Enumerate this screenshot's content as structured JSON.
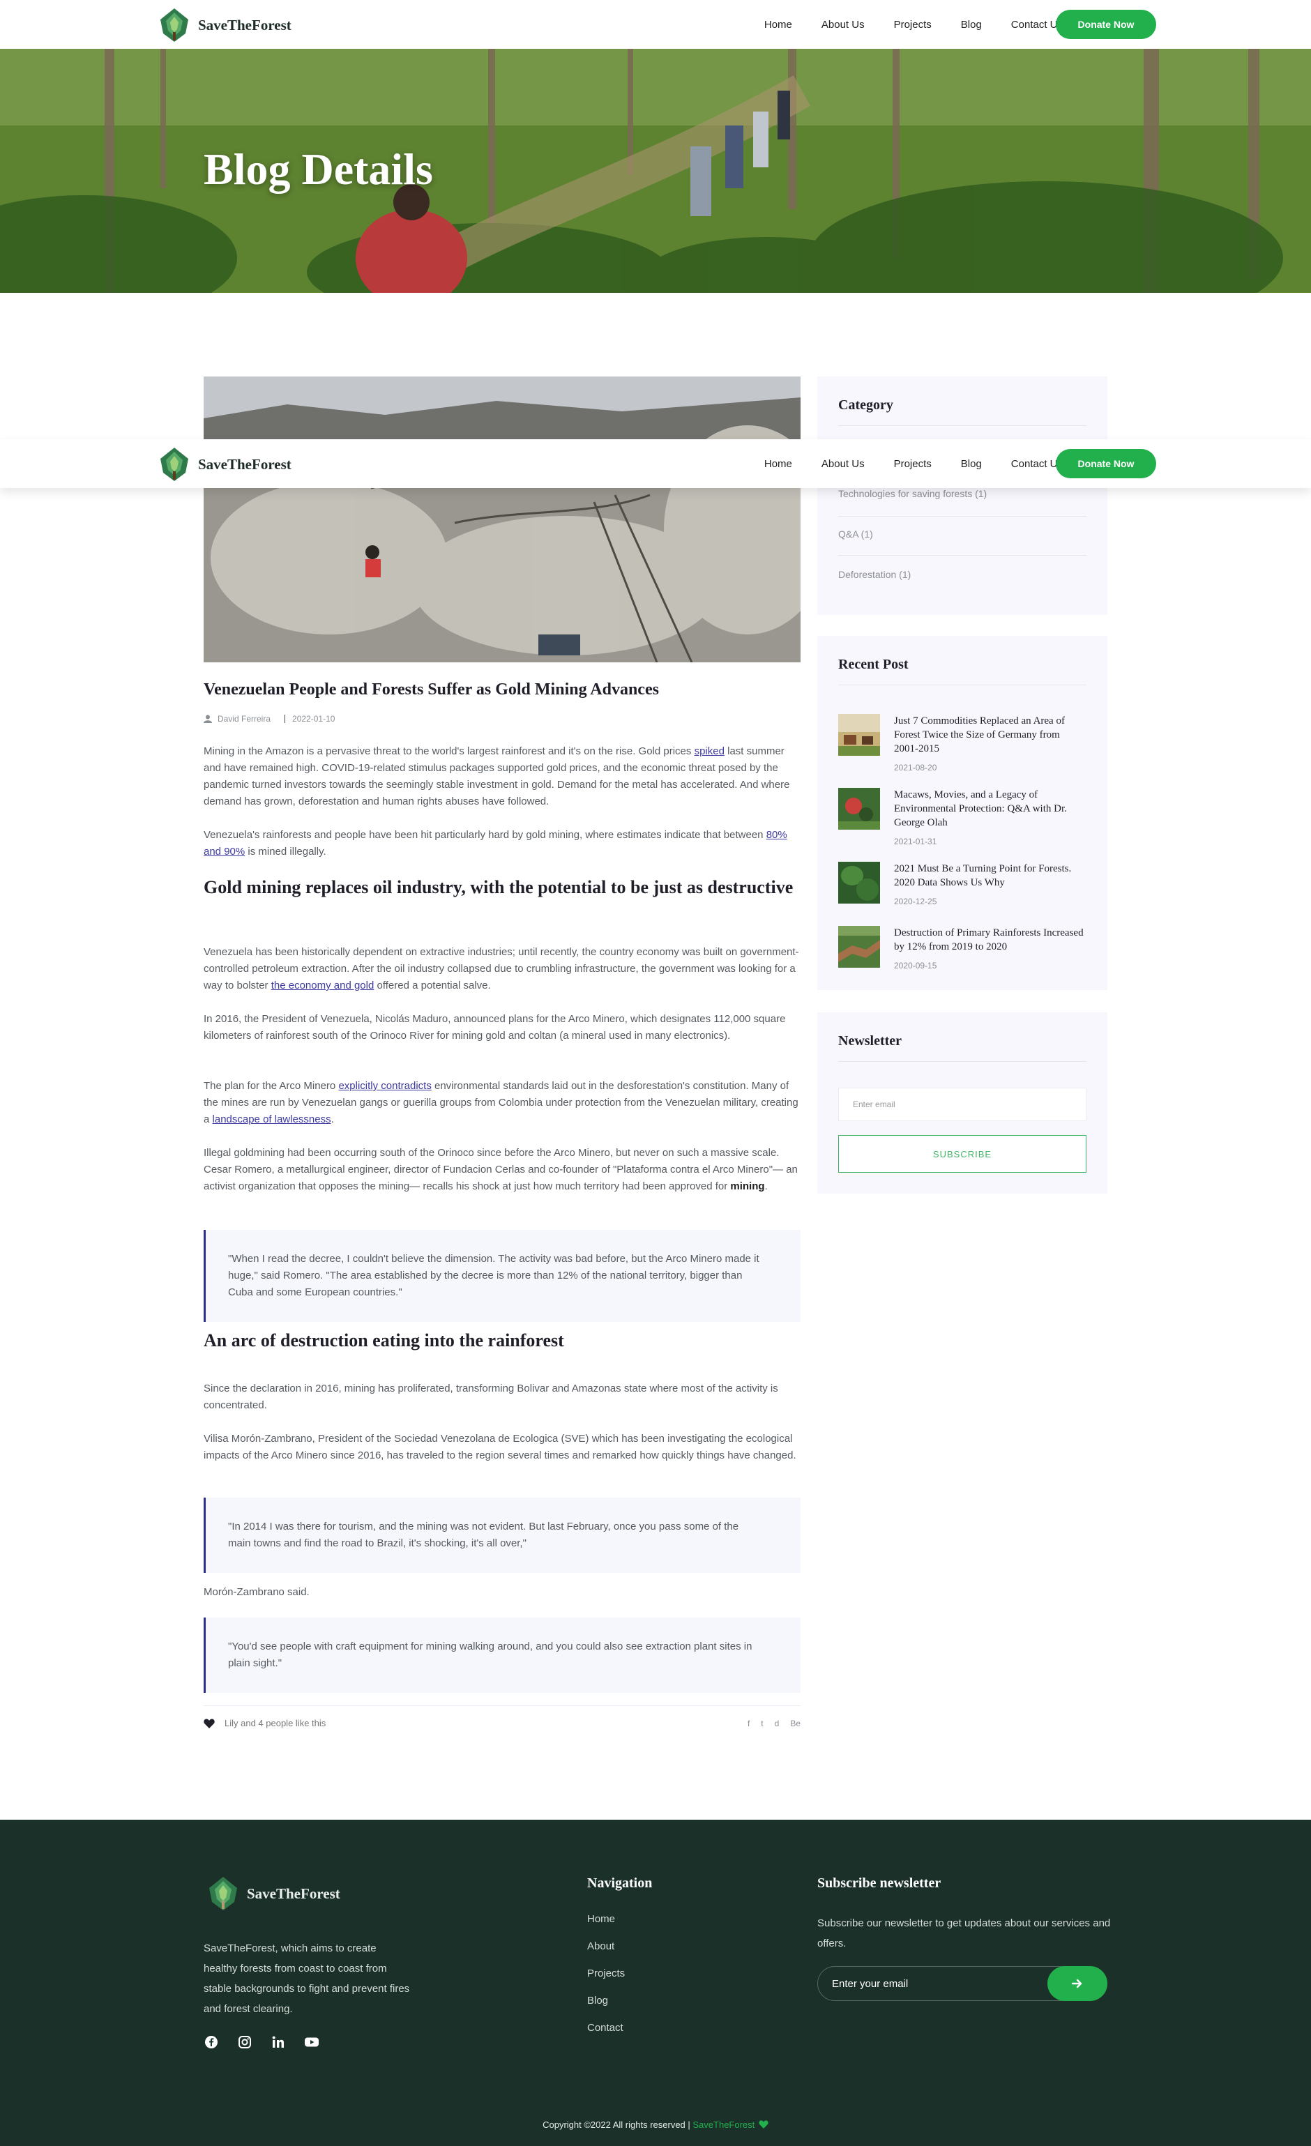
{
  "brand": {
    "name": "SaveTheForest"
  },
  "nav": {
    "items": [
      "Home",
      "About Us",
      "Projects",
      "Blog",
      "Contact Us"
    ],
    "donate": "Donate Now"
  },
  "hero": {
    "title": "Blog Details"
  },
  "post": {
    "title": "Venezuelan People and Forests Suffer as Gold Mining Advances",
    "author": "David Ferreira",
    "date": "2022-01-10",
    "p1": {
      "a": "Mining in the Amazon is a pervasive threat to the world's largest rainforest and it's on the rise. Gold prices ",
      "link": "spiked",
      "b": " last summer and have remained high. COVID-19-related stimulus packages supported gold prices, and the economic threat posed by the pandemic turned investors towards the seemingly stable investment in gold. Demand for the metal has accelerated. And where demand has grown, deforestation and human rights abuses have followed."
    },
    "p2": {
      "a": "Venezuela's rainforests and people have been hit particularly hard by gold mining, where estimates indicate that between ",
      "link": "80% and 90%",
      "b": " is mined illegally."
    },
    "h1": "Gold mining replaces oil industry, with the potential to be just as destructive",
    "p3": {
      "a": "Venezuela has been historically dependent on extractive industries; until recently, the country economy was built on government-controlled petroleum extraction. After the oil industry collapsed due to crumbling infrastructure, the government was looking for a way to bolster ",
      "link": "the economy and gold",
      "b": " offered a potential salve."
    },
    "p4": "In 2016, the President of Venezuela, Nicolás Maduro, announced plans for the Arco Minero, which designates 112,000 square kilometers of rainforest south of the Orinoco River for mining gold and coltan (a mineral used in many electronics).",
    "p5": {
      "a": "The plan for the Arco Minero ",
      "link1": "explicitly contradicts",
      "b": " environmental standards laid out in the desforestation's constitution. Many of the mines are run by Venezuelan gangs or guerilla groups from Colombia under protection from the Venezuelan military, creating a ",
      "link2": "landscape of lawlessness",
      "c": "."
    },
    "p6": {
      "a": "Illegal goldmining had been occurring south of the Orinoco since before the Arco Minero, but never on such a massive scale. Cesar Romero, a metallurgical engineer, director of Fundacion Cerlas and co-founder of \"Plataforma contra el Arco Minero\"— an activist organization that opposes the mining— recalls his shock at just how much territory had been approved for ",
      "bold": "mining",
      "b": "."
    },
    "q1": "\"When I read the decree, I couldn't believe the dimension. The activity was bad before, but the Arco Minero made it huge,\" said Romero. \"The area established by the decree is more than 12% of the national territory, bigger than Cuba and some European countries.\"",
    "h2": "An arc of destruction eating into the rainforest",
    "p7": "Since the declaration in 2016, mining has proliferated, transforming Bolivar and Amazonas state where most of the activity is concentrated.",
    "p8": "Vilisa Morón-Zambrano, President of the Sociedad Venezolana de Ecologica (SVE) which has been investigating the ecological impacts of the Arco Minero since 2016, has traveled to the region several times and remarked how quickly things have changed.",
    "q2": "\"In 2014 I was there for tourism, and the mining was not evident. But last February, once you pass some of the main towns and find the road to Brazil, it's shocking, it's all over,\"",
    "p9": "Morón-Zambrano said.",
    "q3": "\"You'd see people with craft equipment for mining walking around, and you could also see extraction plant sites in plain sight.\"",
    "likes": "Lily and 4 people like this",
    "share": [
      "f",
      "t",
      "d",
      "Be"
    ]
  },
  "sidebar": {
    "category": {
      "title": "Category",
      "items": [
        "Technologies for saving forests (1)",
        "Q&A (1)",
        "Deforestation (1)"
      ]
    },
    "recent": {
      "title": "Recent Post",
      "posts": [
        {
          "title": "Just 7 Commodities Replaced an Area of Forest Twice the Size of Germany from 2001-2015",
          "date": "2021-08-20"
        },
        {
          "title": "Macaws, Movies, and a Legacy of Environmental Protection: Q&A with Dr. George Olah",
          "date": "2021-01-31"
        },
        {
          "title": "2021 Must Be a Turning Point for Forests. 2020 Data Shows Us Why",
          "date": "2020-12-25"
        },
        {
          "title": "Destruction of Primary Rainforests Increased by 12% from 2019 to 2020",
          "date": "2020-09-15"
        }
      ]
    },
    "newsletter": {
      "title": "Newsletter",
      "placeholder": "Enter email",
      "button": "SUBSCRIBE"
    }
  },
  "footer": {
    "about": "SaveTheForest, which aims to create healthy forests from coast to coast from stable backgrounds to fight and prevent fires and forest clearing.",
    "nav_title": "Navigation",
    "nav": [
      "Home",
      "About",
      "Projects",
      "Blog",
      "Contact"
    ],
    "subscribe_title": "Subscribe newsletter",
    "subscribe_text": "Subscribe our newsletter to get updates about our services and offers.",
    "email_placeholder": "Enter your email",
    "copyright": "Copyright ©2022 All rights reserved | ",
    "copyright_brand": "SaveTheForest"
  },
  "colors": {
    "accent": "#21b04b",
    "footer_bg": "#1b3028",
    "link": "#3d3aa0",
    "quote_border": "#2d2f8f",
    "card_bg": "#f8f7fd"
  }
}
